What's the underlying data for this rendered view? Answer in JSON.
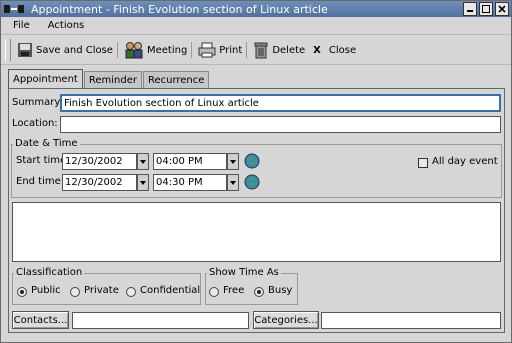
{
  "window": {
    "title": "Appointment - Finish Evolution section of Linux article",
    "app_icon_text": "-=-"
  },
  "menu": {
    "items": [
      {
        "label": "File"
      },
      {
        "label": "Actions"
      }
    ]
  },
  "toolbar": {
    "save_close_label": "Save and Close",
    "meeting_label": "Meeting",
    "print_label": "Print",
    "delete_label": "Delete",
    "close_label": "Close",
    "close_glyph": "X"
  },
  "tabs": [
    {
      "label": "Appointment",
      "active": true
    },
    {
      "label": "Reminder",
      "active": false
    },
    {
      "label": "Recurrence",
      "active": false
    }
  ],
  "form": {
    "summary_label": "Summary:",
    "summary_value": "Finish Evolution section of Linux article",
    "location_label": "Location:",
    "location_value": "",
    "datetime_title": "Date & Time",
    "start_label": "Start time:",
    "start_date": "12/30/2002",
    "start_time": "04:00 PM",
    "end_label": "End time:",
    "end_date": "12/30/2002",
    "end_time": "04:30 PM",
    "all_day_label": "All day event",
    "all_day_checked": false,
    "description": "",
    "classification_title": "Classification",
    "class_public": "Public",
    "class_private": "Private",
    "class_confidential": "Confidential",
    "class_selected": "Public",
    "show_time_title": "Show Time As",
    "show_free": "Free",
    "show_busy": "Busy",
    "show_selected": "Busy",
    "contacts_button": "Contacts...",
    "contacts_value": "",
    "categories_button": "Categories...",
    "categories_value": ""
  },
  "colors": {
    "titlebar": "#5f7fab",
    "window_bg": "#d6d6d6",
    "focus_border": "#3a6ea5"
  },
  "icons": [
    "save-icon",
    "meeting-icon",
    "print-icon",
    "delete-icon",
    "close-icon",
    "timezone-globe-icon"
  ]
}
